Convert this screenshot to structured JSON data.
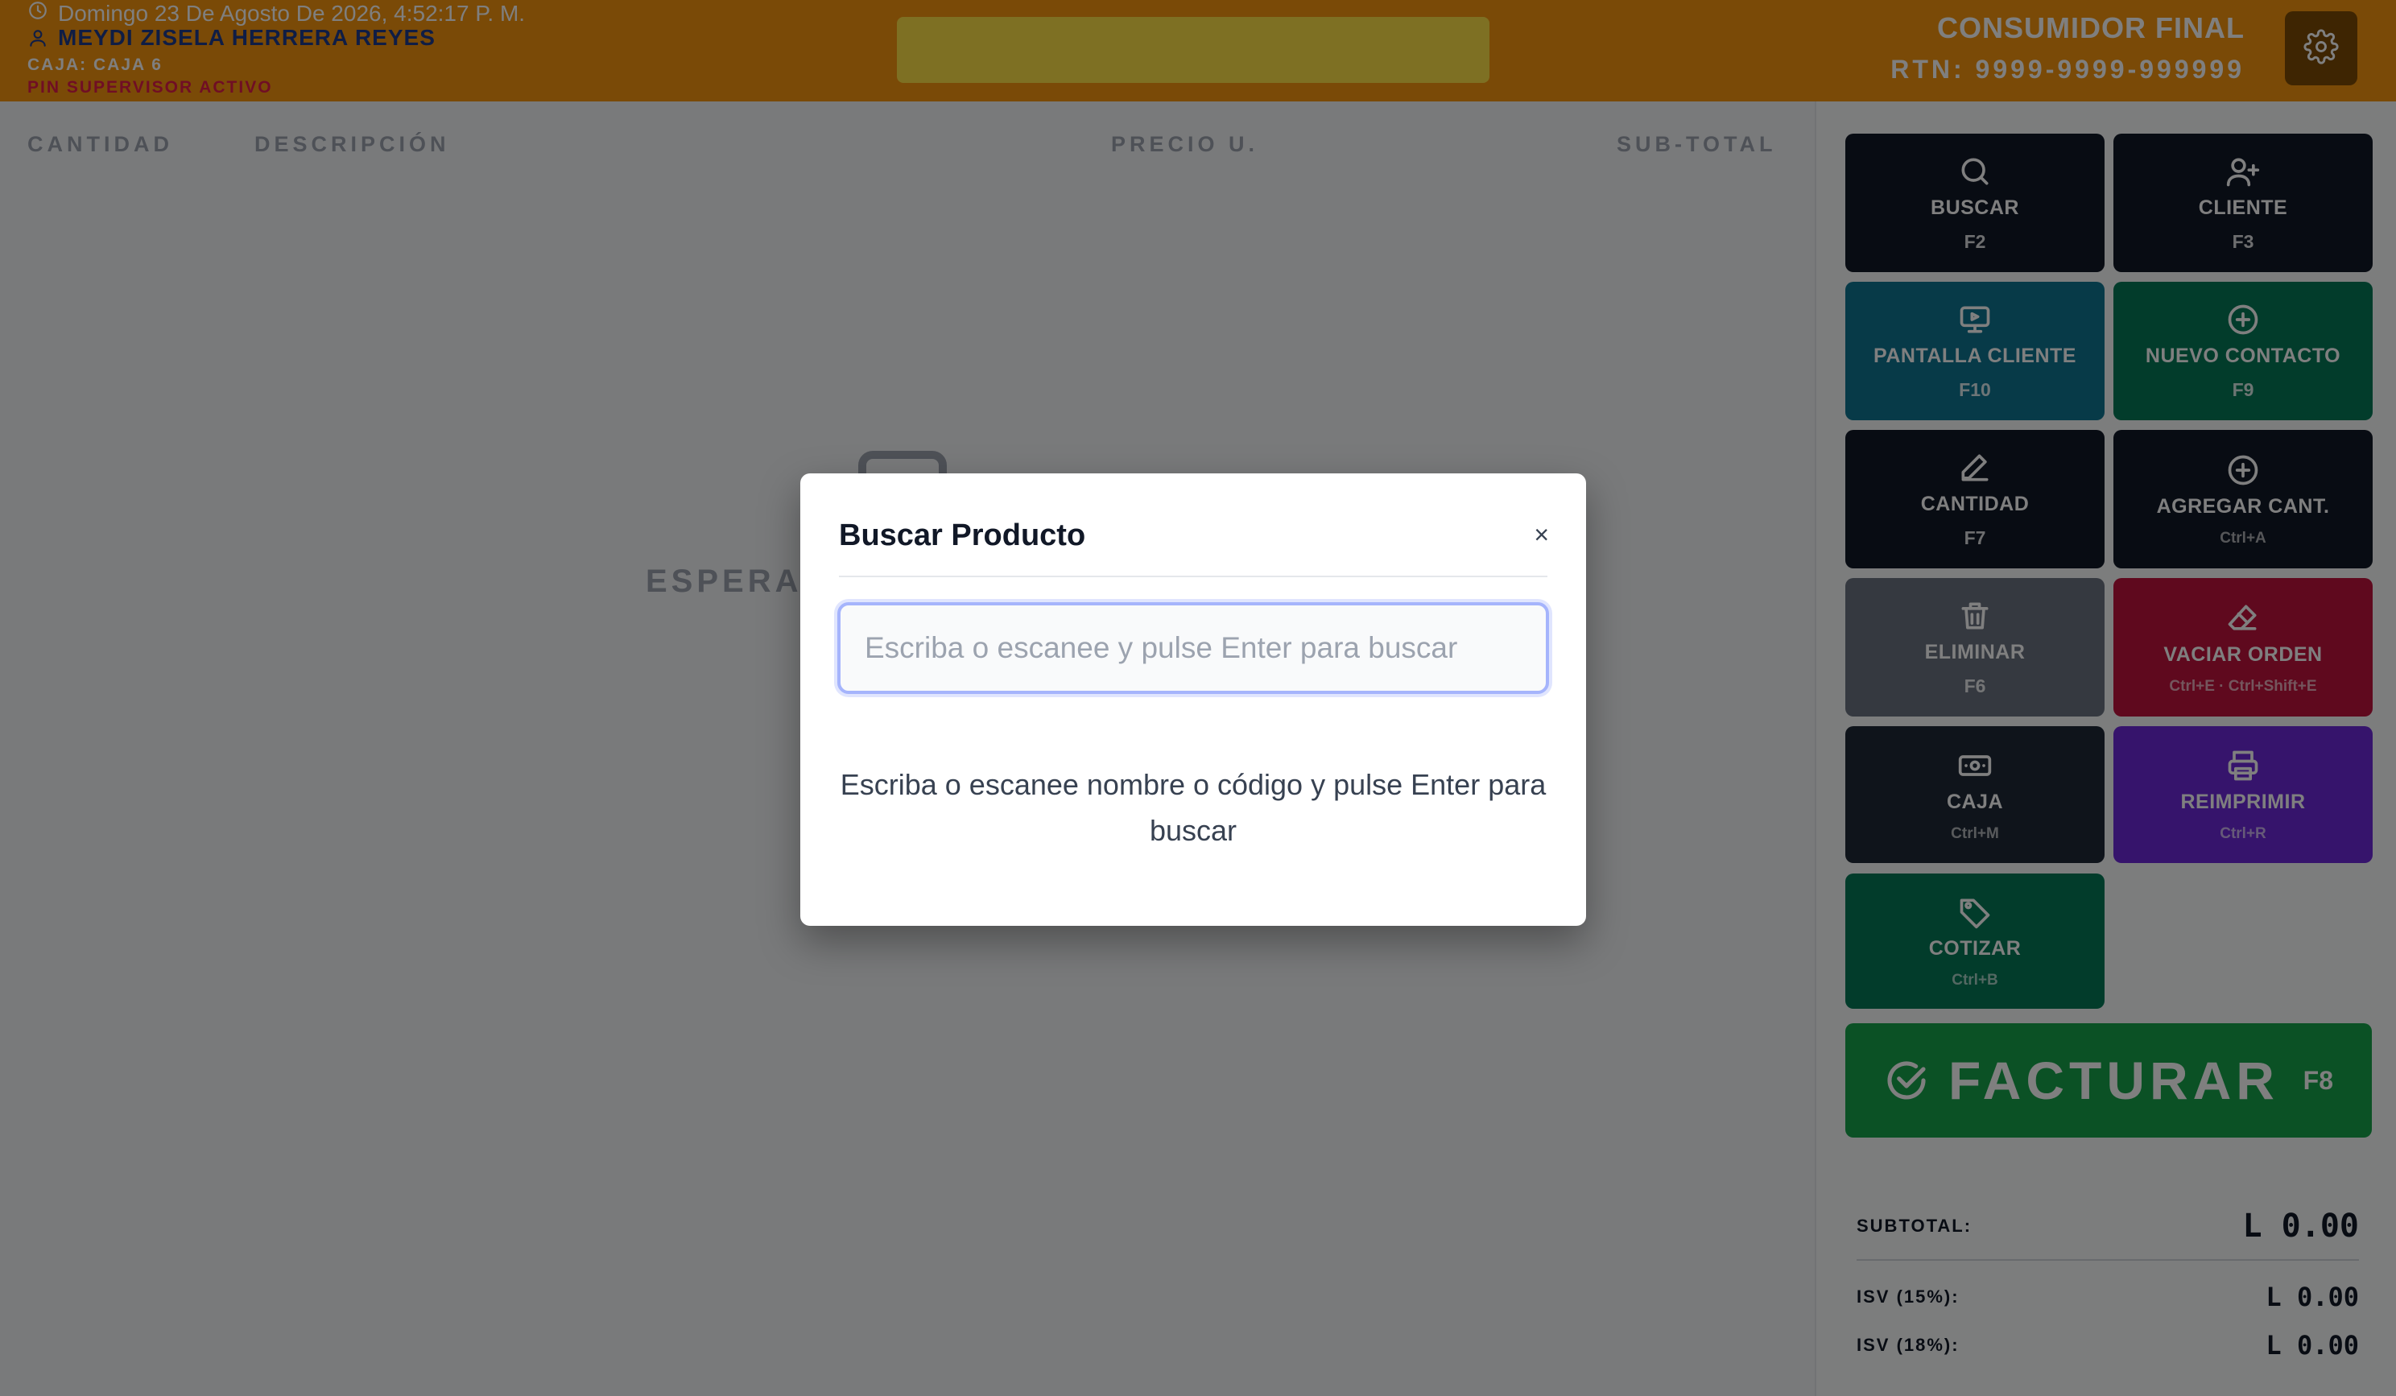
{
  "header": {
    "datetime": "Domingo 23 De Agosto De 2026, 4:52:17 P. M.",
    "user": "MEYDI ZISELA HERRERA REYES",
    "caja": "CAJA: CAJA 6",
    "pin_status": "PIN SUPERVISOR ACTIVO",
    "customer_name": "CONSUMIDOR FINAL",
    "customer_rtn": "RTN: 9999-9999-999999",
    "icons": [
      "clock-icon",
      "user-icon",
      "gear-icon"
    ]
  },
  "table": {
    "columns": [
      "CANTIDAD",
      "DESCRIPCIÓN",
      "PRECIO U.",
      "SUB-TOTAL"
    ],
    "empty_text": "ESPERANDO PRODUCTOS"
  },
  "actions": [
    {
      "label": "BUSCAR",
      "key": "F2",
      "icon": "search-icon",
      "color": "#111827"
    },
    {
      "label": "CLIENTE",
      "key": "F3",
      "icon": "user-plus-icon",
      "color": "#111827"
    },
    {
      "label": "PANTALLA CLIENTE",
      "key": "F10",
      "icon": "monitor-play-icon",
      "color": "#0e7490"
    },
    {
      "label": "NUEVO CONTACTO",
      "key": "F9",
      "icon": "plus-circle-icon",
      "color": "#047857"
    },
    {
      "label": "CANTIDAD",
      "key": "F7",
      "icon": "pencil-icon",
      "color": "#111827"
    },
    {
      "label": "AGREGAR CANT.",
      "key": "Ctrl+A",
      "icon": "plus-circle-icon",
      "color": "#111827"
    },
    {
      "label": "ELIMINAR",
      "key": "F6",
      "icon": "trash-icon",
      "color": "#6b7280"
    },
    {
      "label": "VACIAR ORDEN",
      "key": "Ctrl+E · Ctrl+Shift+E",
      "icon": "eraser-icon",
      "color": "#be123c"
    },
    {
      "label": "CAJA",
      "key": "Ctrl+M",
      "icon": "cash-icon",
      "color": "#1f2937"
    },
    {
      "label": "REIMPRIMIR",
      "key": "Ctrl+R",
      "icon": "printer-icon",
      "color": "#6d28d9"
    },
    {
      "label": "COTIZAR",
      "key": "Ctrl+B",
      "icon": "tag-icon",
      "color": "#047857"
    }
  ],
  "facturar": {
    "label": "FACTURAR",
    "key": "F8",
    "color": "#16a34a"
  },
  "totals": {
    "subtotal_label": "SUBTOTAL:",
    "subtotal_value": "L 0.00",
    "isv15_label": "ISV (15%):",
    "isv15_value": "L 0.00",
    "isv18_label": "ISV (18%):",
    "isv18_value": "L 0.00"
  },
  "modal": {
    "title": "Buscar Producto",
    "close": "×",
    "input_placeholder": "Escriba o escanee y pulse Enter para buscar",
    "input_value": "",
    "hint": "Escriba o escanee nombre o código y pulse Enter para buscar"
  },
  "colors": {
    "header_bg": "#f5950f",
    "header_banner": "#fde047",
    "user_text": "#1e3a8a",
    "pin_text": "#e11d48"
  }
}
